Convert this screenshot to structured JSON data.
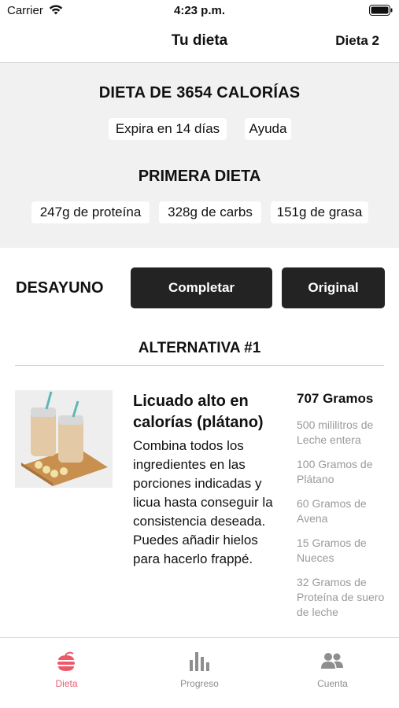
{
  "status_bar": {
    "carrier": "Carrier",
    "time": "4:23 p.m."
  },
  "nav": {
    "title": "Tu dieta",
    "right_button": "Dieta 2"
  },
  "summary": {
    "calories_title": "DIETA DE 3654 CALORÍAS",
    "expires": "Expira en 14 días",
    "help": "Ayuda",
    "diet_name": "PRIMERA DIETA",
    "macros": [
      "247g de proteína",
      "328g de carbs",
      "151g de grasa"
    ]
  },
  "meal": {
    "label": "DESAYUNO",
    "complete_button": "Completar",
    "original_button": "Original",
    "alternative_title": "ALTERNATIVA #1"
  },
  "recipe": {
    "title": "Licuado alto en calorías (plátano)",
    "description": "Combina todos los ingredientes en las porciones indicadas y licua hasta conseguir la consistencia deseada. Puedes añadir hielos para hacerlo frappé.",
    "total": "707 Gramos",
    "ingredients": [
      "500 mililitros de Leche entera",
      "100 Gramos de Plátano",
      "60 Gramos de Avena",
      "15 Gramos de Nueces",
      "32 Gramos de Proteína de suero de leche"
    ]
  },
  "tabs": [
    {
      "label": "Dieta",
      "icon": "food-icon",
      "active": true
    },
    {
      "label": "Progreso",
      "icon": "bar-chart-icon",
      "active": false
    },
    {
      "label": "Cuenta",
      "icon": "people-icon",
      "active": false
    }
  ],
  "colors": {
    "accent": "#ec5a6a",
    "button_bg": "#232323",
    "summary_bg": "#f1f1f1"
  }
}
